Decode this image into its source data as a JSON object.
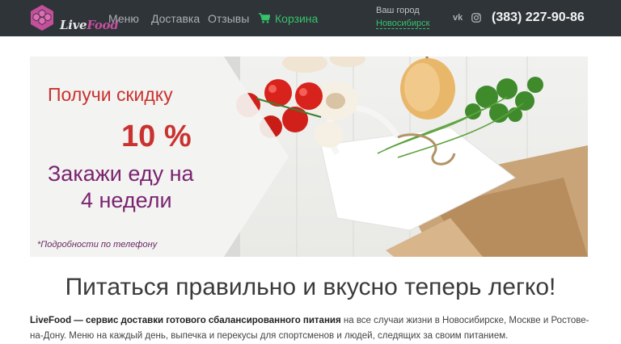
{
  "header": {
    "logo": {
      "part1": "Live",
      "part2": "Food"
    },
    "nav": {
      "menu": "Меню",
      "delivery": "Доставка",
      "reviews": "Отзывы",
      "cart": "Корзина"
    },
    "city": {
      "label": "Ваш город",
      "value": "Новосибирск"
    },
    "social": {
      "vk": "vk",
      "instagram_icon": "instagram-icon"
    },
    "phone": "(383) 227-90-86"
  },
  "banner": {
    "line1": "Получи скидку",
    "line2": "10 %",
    "line3": "Закажи еду на",
    "line4": "4 недели",
    "note": "*Подробности по телефону"
  },
  "main": {
    "headline": "Питаться правильно и вкусно теперь легко!",
    "intro_brand": "LiveFood — сервис доставки готового сбалансированного питания",
    "intro_rest": " на все случаи жизни в Новосибирске, Москве и Ростове-на-Дону. Меню на каждый день, выпечка и перекусы для спортсменов и людей, следящих за своим питанием."
  },
  "colors": {
    "header_bg": "#2f3439",
    "accent_green": "#35c46a",
    "promo_red": "#c9322f",
    "promo_purple": "#7a2470",
    "logo_pink": "#c44f9b"
  }
}
